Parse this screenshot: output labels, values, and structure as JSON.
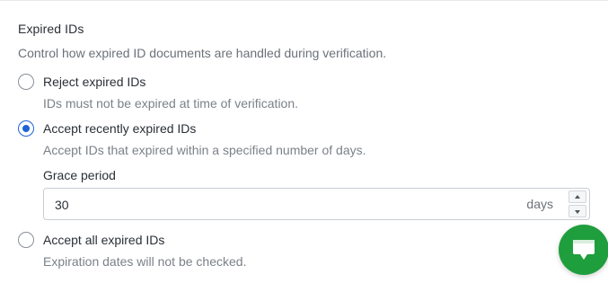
{
  "section": {
    "title": "Expired IDs",
    "description": "Control how expired ID documents are handled during verification."
  },
  "options": [
    {
      "label": "Reject expired IDs",
      "help": "IDs must not be expired at time of verification.",
      "selected": false
    },
    {
      "label": "Accept recently expired IDs",
      "help": "Accept IDs that expired within a specified number of days.",
      "selected": true
    },
    {
      "label": "Accept all expired IDs",
      "help": "Expiration dates will not be checked.",
      "selected": false
    }
  ],
  "grace_period": {
    "label": "Grace period",
    "value": "30",
    "unit": "days"
  },
  "icons": {
    "chat": "chat-bubble-icon",
    "increment": "chevron-up-icon",
    "decrement": "chevron-down-icon"
  },
  "colors": {
    "accent": "#1e63d6",
    "chat_button": "#1f9e3d",
    "muted_text": "#6b7178"
  }
}
